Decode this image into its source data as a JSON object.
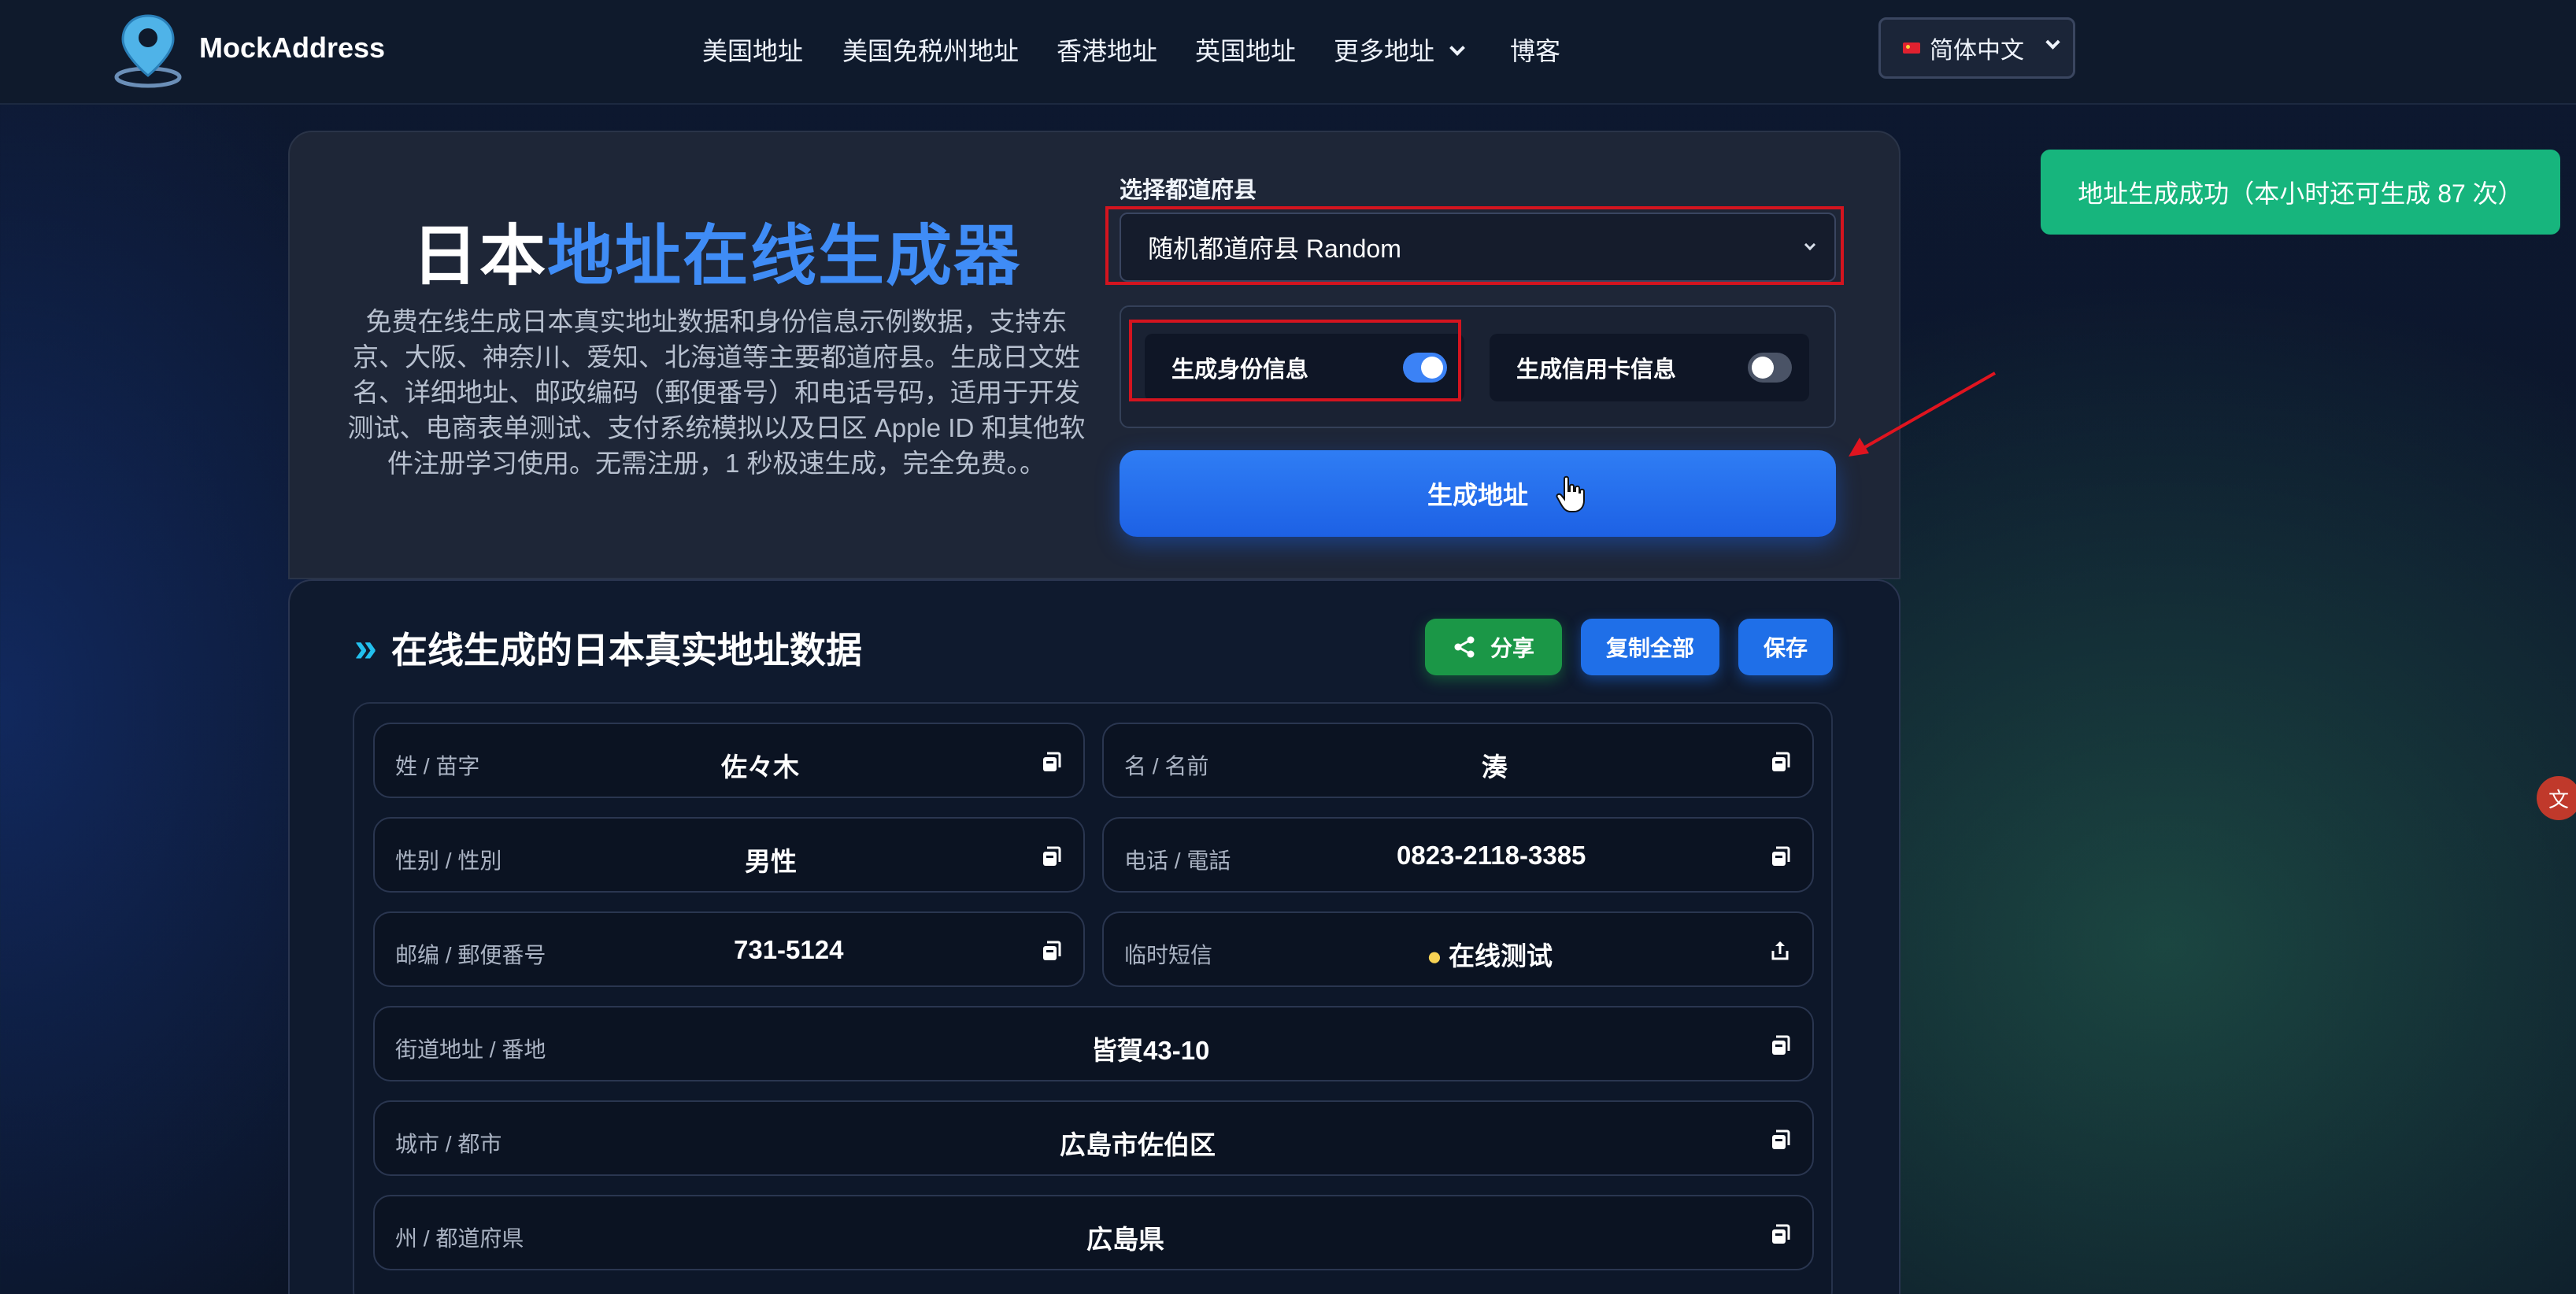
{
  "nav": {
    "brand": "MockAddress",
    "links": [
      "美国地址",
      "美国免税州地址",
      "香港地址",
      "英国地址",
      "更多地址",
      "博客"
    ],
    "language": "简体中文"
  },
  "hero": {
    "title_part1": "日本",
    "title_part2": "地址在线生成器",
    "description": "免费在线生成日本真实地址数据和身份信息示例数据，支持东京、大阪、神奈川、爱知、北海道等主要都道府县。生成日文姓名、详细地址、邮政编码（郵便番号）和电话号码，适用于开发测试、电商表单测试、支付系统模拟以及日区 Apple ID 和其他软件注册学习使用。无需注册，1 秒极速生成，完全免费。。"
  },
  "form": {
    "prefecture_label": "选择都道府县",
    "prefecture_value": "随机都道府县 Random",
    "toggle_identity_label": "生成身份信息",
    "toggle_identity_on": true,
    "toggle_card_label": "生成信用卡信息",
    "toggle_card_on": false,
    "generate_label": "生成地址"
  },
  "toast": "地址生成成功（本小时还可生成 87 次）",
  "results": {
    "title": "在线生成的日本真实地址数据",
    "share_label": "分享",
    "copy_all_label": "复制全部",
    "save_label": "保存",
    "fields": {
      "surname": {
        "label": "姓 / 苗字",
        "value": "佐々木"
      },
      "given_name": {
        "label": "名 / 名前",
        "value": "湊"
      },
      "gender": {
        "label": "性别 / 性別",
        "value": "男性"
      },
      "phone": {
        "label": "电话 / 電話",
        "value": "0823-2118-3385"
      },
      "postal": {
        "label": "邮编 / 郵便番号",
        "value": "731-5124"
      },
      "sms": {
        "label": "临时短信",
        "value": "在线测试"
      },
      "street": {
        "label": "街道地址 / 番地",
        "value": "皆賀43-10"
      },
      "city": {
        "label": "城市 / 都市",
        "value": "広島市佐伯区"
      },
      "prefecture": {
        "label": "州 / 都道府県",
        "value": "広島県"
      }
    }
  },
  "colors": {
    "accent_blue": "#3f8cf6",
    "success_green": "#17b57d",
    "highlight_red": "#d4141f"
  }
}
